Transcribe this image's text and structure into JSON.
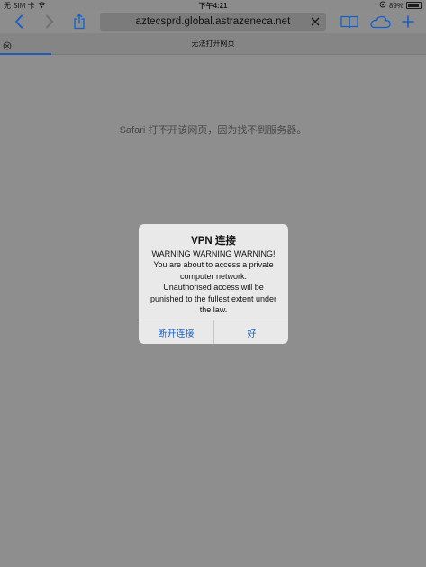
{
  "status_bar": {
    "carrier": "无 SIM 卡",
    "time": "下午4:21",
    "battery_text": "89%",
    "battery_level": 0.89
  },
  "toolbar": {
    "url": "aztecsprd.global.astrazeneca.net",
    "icons": [
      "back-icon",
      "forward-icon",
      "share-icon",
      "clear-icon",
      "bookmarks-icon",
      "icloud-tabs-icon",
      "new-tab-icon"
    ]
  },
  "tab": {
    "title": "无法打开网页"
  },
  "page": {
    "error_message": "Safari 打不开该网页，因为找不到服务器。"
  },
  "alert": {
    "title": "VPN 连接",
    "message": "WARNING WARNING WARNING!\nYou are about to access a private computer network.\nUnauthorised access will be punished to the fullest extent under the law.",
    "disconnect_label": "断开连接",
    "ok_label": "好"
  },
  "colors": {
    "accent": "#1560c9",
    "dim_background": "#8e8e8e",
    "alert_background": "#e9e9e9"
  }
}
